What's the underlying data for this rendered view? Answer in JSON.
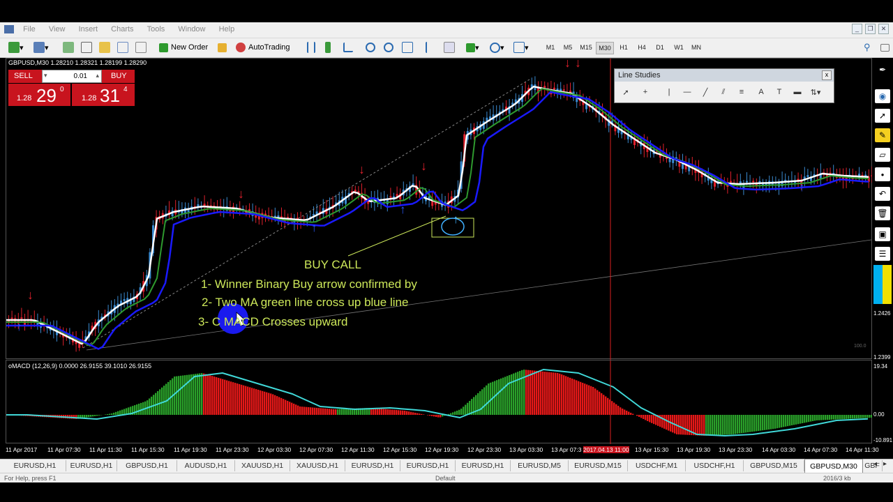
{
  "menu": {
    "items": [
      "File",
      "View",
      "Insert",
      "Charts",
      "Tools",
      "Window",
      "Help"
    ]
  },
  "toolbar": {
    "new_order_label": "New Order",
    "autotrading_label": "AutoTrading",
    "timeframes": [
      "M1",
      "M5",
      "M15",
      "M30",
      "H1",
      "H4",
      "D1",
      "W1",
      "MN"
    ],
    "active_timeframe": "M30"
  },
  "chart": {
    "header": "GBPUSD,M30  1.28210 1.28321 1.28199 1.28290",
    "sell_label": "SELL",
    "buy_label": "BUY",
    "lot_value": "0.01",
    "sell_price_prefix": "1.28",
    "sell_price_big": "29",
    "sell_price_sup": "0",
    "buy_price_prefix": "1.28",
    "buy_price_big": "31",
    "buy_price_sup": "4",
    "price_labels": [
      "1.2426",
      "1.2399"
    ],
    "level_label": "100.0",
    "annotations": {
      "title": "BUY CALL",
      "line1": "1- Winner Binary Buy arrow confirmed by",
      "line2": "2- Two MA green line cross up blue line",
      "line3": "3- C MACD Crosses upward"
    }
  },
  "macd": {
    "title": "oMACD (12,26,9) 0.0000 26.9155 39.1010 26.9155",
    "axis_labels": [
      "19.34",
      "0.00",
      "-10.891"
    ]
  },
  "time_axis": [
    "11 Apr 2017",
    "11 Apr 07:30",
    "11 Apr 11:30",
    "11 Apr 15:30",
    "11 Apr 19:30",
    "11 Apr 23:30",
    "12 Apr 03:30",
    "12 Apr 07:30",
    "12 Apr 11:30",
    "12 Apr 15:30",
    "12 Apr 19:30",
    "12 Apr 23:30",
    "13 Apr 03:30",
    "13 Apr 07:3",
    "2017.04.13 11:00",
    "13 Apr 15:30",
    "13 Apr 19:30",
    "13 Apr 23:30",
    "14 Apr 03:30",
    "14 Apr 07:30",
    "14 Apr 11:30"
  ],
  "line_studies": {
    "title": "Line Studies",
    "close": "x"
  },
  "tabs": [
    "EURUSD,H1",
    "EURUSD,H1",
    "GBPUSD,H1",
    "AUDUSD,H1",
    "XAUUSD,H1",
    "XAUUSD,H1",
    "EURUSD,H1",
    "EURUSD,H1",
    "EURUSD,H1",
    "EURUSD,M5",
    "EURUSD,M15",
    "USDCHF,M1",
    "USDCHF,H1",
    "GBPUSD,M15",
    "GBPUSD,M30",
    "GBF"
  ],
  "active_tab": "GBPUSD,M30",
  "status": {
    "help": "For Help, press F1",
    "profile": "Default",
    "traffic": "2016/3 kb"
  },
  "colors": {
    "bull": "#3a8ad0",
    "bear": "#e0202c",
    "ma_green": "#2e9a2e",
    "ma_blue": "#1a1aff",
    "ma_white": "#ffffff",
    "macd_green": "#2aa02a",
    "macd_red": "#e51818",
    "signal": "#40d8d8",
    "annotation": "#cde85a",
    "sell_btn": "#c8141e"
  }
}
